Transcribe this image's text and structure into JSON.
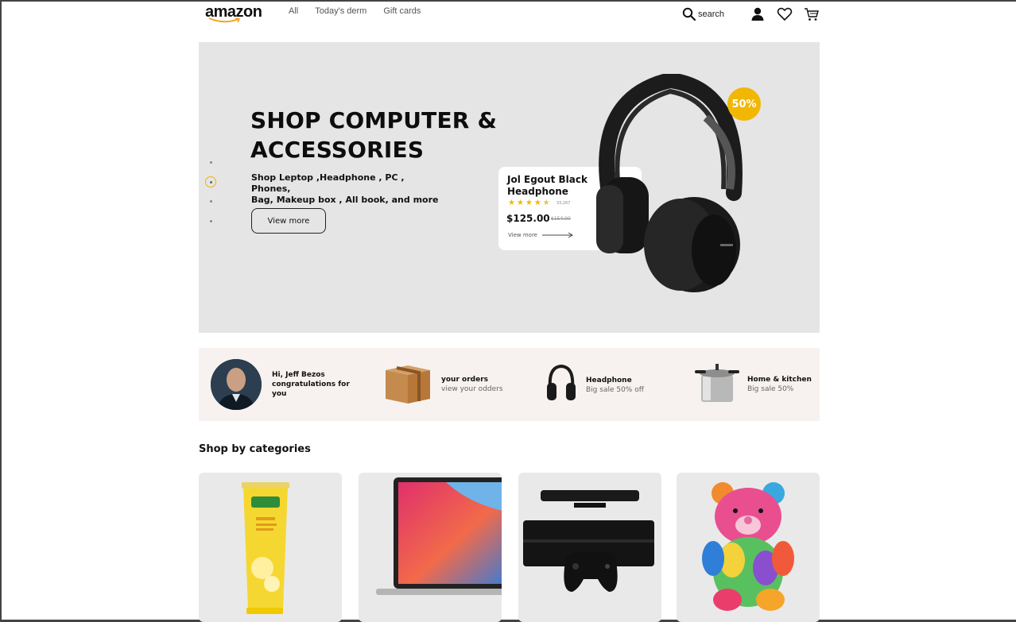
{
  "header": {
    "logo": "amazon",
    "nav": [
      "All",
      "Today's derm",
      "Gift cards"
    ],
    "search_label": "search"
  },
  "hero": {
    "title_line1": "SHOP COMPUTER &",
    "title_line2": "ACCESSORIES",
    "subtitle_line1": "Shop Leptop ,Headphone , PC , Phones,",
    "subtitle_line2": "Bag, Makeup box , All book, and more",
    "button_label": "View more",
    "slides_total": 4,
    "slide_active": 2,
    "discount_badge": "50%",
    "product": {
      "name_line1": "Jol Egout Black",
      "name_line2": "Headphone",
      "rating": 4.5,
      "reviews": "33,267",
      "price": "$125.00",
      "old_price": "$154.00",
      "view_label": "View more"
    }
  },
  "strip": {
    "greeting_line1": "Hi, Jeff Bezos",
    "greeting_line2": "congratulations for",
    "greeting_line3": "you",
    "orders_title": "your orders",
    "orders_sub": "view your odders",
    "headphone_title": "Headphone",
    "headphone_sub": "Big sale 50% off",
    "kitchen_title": "Home & kitchen",
    "kitchen_sub": "Big sale 50%"
  },
  "categories": {
    "title": "Shop by categories",
    "items": [
      {
        "icon": "face-wash-tube-image"
      },
      {
        "icon": "laptop-image"
      },
      {
        "icon": "game-console-image"
      },
      {
        "icon": "teddy-bear-image"
      }
    ]
  },
  "colors": {
    "accent": "#f2b705",
    "hero_bg": "#e5e5e5",
    "strip_bg": "#f7f2ef",
    "card_bg": "#e9e9e9"
  }
}
